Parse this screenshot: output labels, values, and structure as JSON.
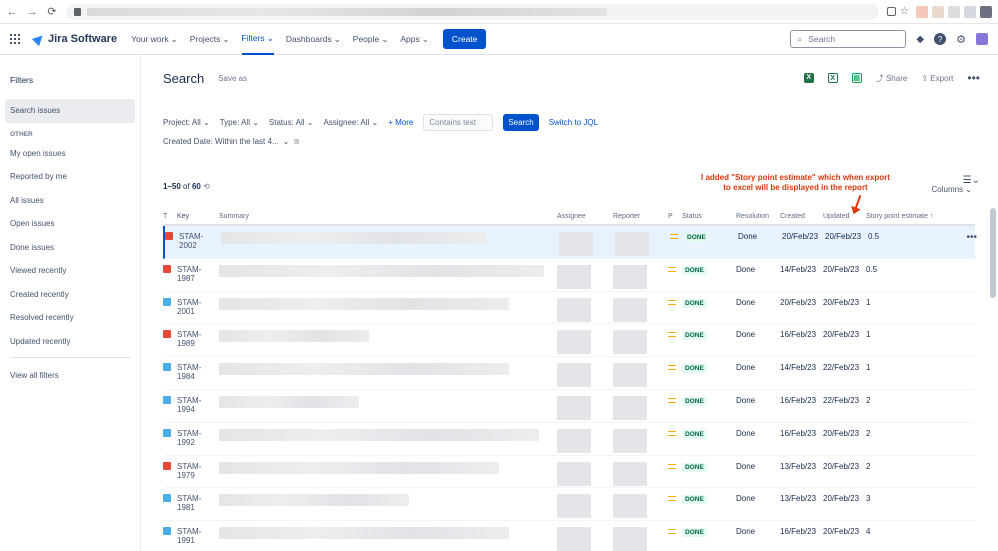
{
  "browser": {
    "back": "←",
    "forward": "→",
    "reload": "C"
  },
  "topnav": {
    "product": "Jira Software",
    "menu": [
      {
        "label": "Your work",
        "active": false
      },
      {
        "label": "Projects",
        "active": false
      },
      {
        "label": "Filters",
        "active": true
      },
      {
        "label": "Dashboards",
        "active": false
      },
      {
        "label": "People",
        "active": false
      },
      {
        "label": "Apps",
        "active": false
      }
    ],
    "create": "Create",
    "search_placeholder": "Search"
  },
  "sidebar": {
    "title": "Filters",
    "search_issues": "Search issues",
    "section": "OTHER",
    "items": [
      "My open issues",
      "Reported by me",
      "All issues",
      "Open issues",
      "Done issues",
      "Viewed recently",
      "Created recently",
      "Resolved recently",
      "Updated recently"
    ],
    "view_all": "View all filters"
  },
  "page": {
    "title": "Search",
    "save_as": "Save as",
    "share": "Share",
    "export": "Export",
    "count_range": "1–50",
    "count_of": "of",
    "count_total": "60",
    "columns": "Columns",
    "note_line1": "I added \"Story point estimate\" which when export",
    "note_line2": "to excel will be displayed in the report"
  },
  "filters": {
    "project": "Project: All",
    "type": "Type: All",
    "status": "Status: All",
    "assignee": "Assignee: All",
    "more": "More",
    "text_placeholder": "Contains text",
    "search_btn": "Search",
    "switch_jql": "Switch to JQL",
    "created_date": "Created Date: Within the last 4..."
  },
  "table": {
    "headers": {
      "t": "T",
      "key": "Key",
      "summary": "Summary",
      "assignee": "Assignee",
      "reporter": "Reporter",
      "p": "P",
      "status": "Status",
      "resolution": "Resolution",
      "created": "Created",
      "updated": "Updated",
      "story_points": "Story point estimate"
    },
    "rows": [
      {
        "type": "bug",
        "key": "STAM-2002",
        "status": "DONE",
        "resolution": "Done",
        "created": "20/Feb/23",
        "updated": "20/Feb/23",
        "sp": "0.5"
      },
      {
        "type": "bug",
        "key": "STAM-1987",
        "status": "DONE",
        "resolution": "Done",
        "created": "14/Feb/23",
        "updated": "20/Feb/23",
        "sp": "0.5"
      },
      {
        "type": "task",
        "key": "STAM-2001",
        "status": "DONE",
        "resolution": "Done",
        "created": "20/Feb/23",
        "updated": "20/Feb/23",
        "sp": "1"
      },
      {
        "type": "bug",
        "key": "STAM-1989",
        "status": "DONE",
        "resolution": "Done",
        "created": "16/Feb/23",
        "updated": "20/Feb/23",
        "sp": "1"
      },
      {
        "type": "task",
        "key": "STAM-1984",
        "status": "DONE",
        "resolution": "Done",
        "created": "14/Feb/23",
        "updated": "22/Feb/23",
        "sp": "1"
      },
      {
        "type": "task",
        "key": "STAM-1994",
        "status": "DONE",
        "resolution": "Done",
        "created": "16/Feb/23",
        "updated": "22/Feb/23",
        "sp": "2"
      },
      {
        "type": "task",
        "key": "STAM-1992",
        "status": "DONE",
        "resolution": "Done",
        "created": "16/Feb/23",
        "updated": "20/Feb/23",
        "sp": "2"
      },
      {
        "type": "bug",
        "key": "STAM-1979",
        "status": "DONE",
        "resolution": "Done",
        "created": "13/Feb/23",
        "updated": "20/Feb/23",
        "sp": "2"
      },
      {
        "type": "task",
        "key": "STAM-1981",
        "status": "DONE",
        "resolution": "Done",
        "created": "13/Feb/23",
        "updated": "20/Feb/23",
        "sp": "3"
      },
      {
        "type": "task",
        "key": "STAM-1991",
        "status": "DONE",
        "resolution": "Done",
        "created": "16/Feb/23",
        "updated": "20/Feb/23",
        "sp": "4"
      }
    ]
  }
}
